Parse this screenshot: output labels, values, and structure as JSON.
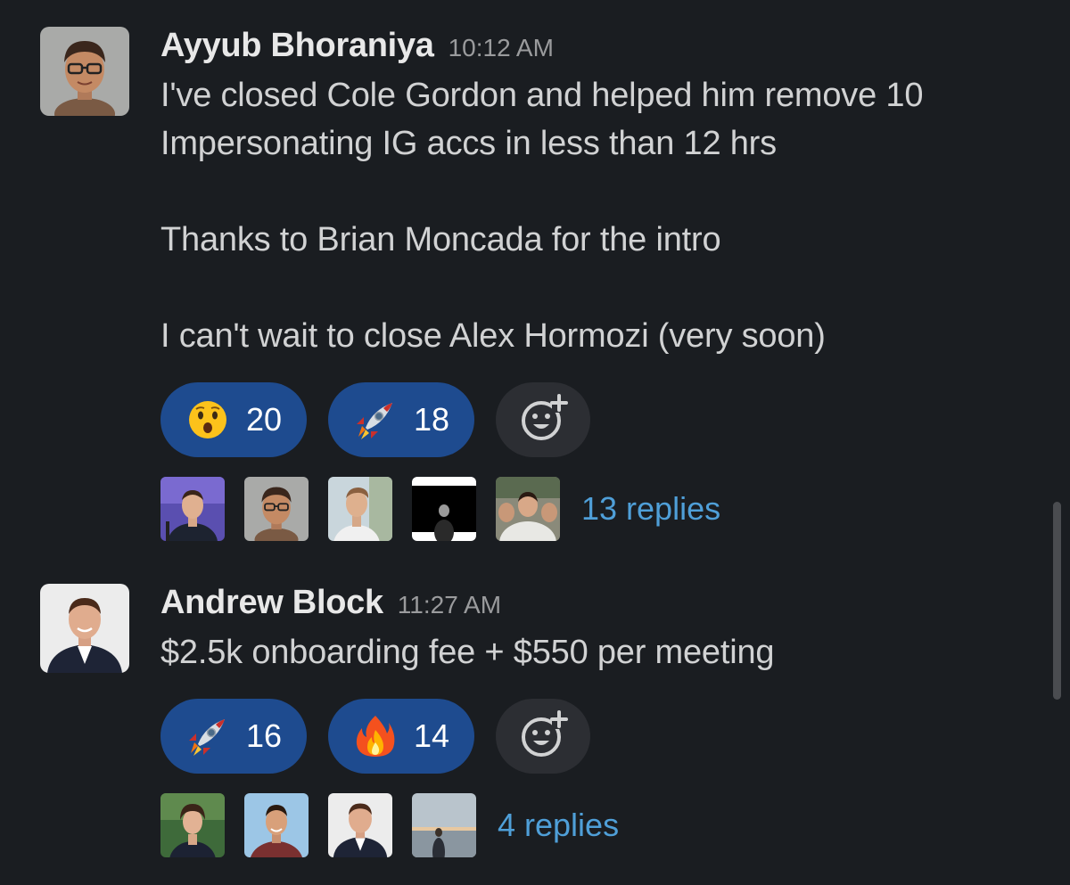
{
  "messages": [
    {
      "author": "Ayyub Bhoraniya",
      "time": "10:12 AM",
      "avatar": "cartoon-avatar",
      "paragraphs": [
        "I've closed Cole Gordon and helped him remove 10 Impersonating IG accs in less than 12 hrs",
        "Thanks to Brian Moncada for the intro",
        "I can't wait to close Alex Hormozi (very soon)"
      ],
      "reactions": [
        {
          "emoji": "hushed-face",
          "count": "20"
        },
        {
          "emoji": "rocket",
          "count": "18"
        }
      ],
      "add_reaction_icon": "add-emoji-icon",
      "thread_avatars": [
        "speaker-photo",
        "cartoon-avatar",
        "man-photo",
        "black-frame-photo",
        "group-photo"
      ],
      "replies": "13 replies"
    },
    {
      "author": "Andrew Block",
      "time": "11:27 AM",
      "avatar": "suit-photo",
      "paragraphs": [
        "$2.5k onboarding fee + $550 per meeting"
      ],
      "reactions": [
        {
          "emoji": "rocket",
          "count": "16"
        },
        {
          "emoji": "fire",
          "count": "14"
        }
      ],
      "add_reaction_icon": "add-emoji-icon",
      "thread_avatars": [
        "outdoor-photo",
        "smiling-photo",
        "suit-photo",
        "beach-photo"
      ],
      "replies": "4 replies"
    }
  ],
  "colors": {
    "background": "#1a1d21",
    "reaction_selected": "#1e4b8f",
    "reaction_add": "#2c2e33",
    "link": "#4f9fd8",
    "timestamp": "#9a9b9d"
  }
}
